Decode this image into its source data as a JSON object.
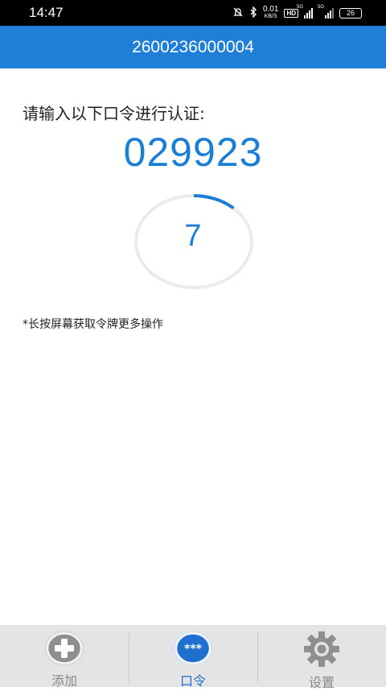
{
  "status_bar": {
    "time": "14:47",
    "net_speed_value": "0.01",
    "net_speed_unit": "KB/S",
    "hd_badge": "HD",
    "signal1_label": "5G",
    "signal2_label": "5G",
    "battery": "26"
  },
  "header": {
    "title": "2600236000004"
  },
  "main": {
    "prompt": "请输入以下口令进行认证:",
    "code": "029923",
    "countdown": "7",
    "countdown_progress": 0.12,
    "hint": "*长按屏幕获取令牌更多操作"
  },
  "tabs": [
    {
      "label": "添加",
      "icon": "plus-icon",
      "active": false
    },
    {
      "label": "口令",
      "icon": "password-icon",
      "active": true
    },
    {
      "label": "设置",
      "icon": "gear-icon",
      "active": false
    }
  ],
  "colors": {
    "accent": "#1e7ed8",
    "code": "#1a7fd4",
    "tabbar": "#e4e4e4"
  }
}
